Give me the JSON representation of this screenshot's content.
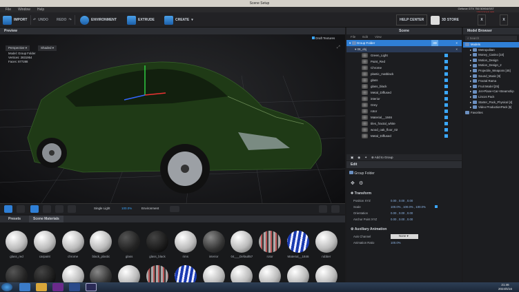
{
  "window": {
    "title": "Scene Setup",
    "menu": [
      "File",
      "Window",
      "Help"
    ],
    "gpu": "Geforce GTX 750 50904/SST",
    "gpu_sub": "1357/2048 MB"
  },
  "toolbar": {
    "import": "IMPORT",
    "undo": "UNDO",
    "redo": "REDO",
    "environment": "ENVIRONMENT",
    "extrude": "EXTRUDE",
    "create": "CREATE",
    "help": "HELP CENTER",
    "store": "3D STORE",
    "close": "X",
    "expand": "X"
  },
  "preview": {
    "title": "Preview",
    "draft": "Draft Textures",
    "view": "Perspective",
    "shade": "Shaded",
    "model_label": "Model:",
    "model": "Group Folder",
    "vertices_label": "Vertices:",
    "vertices": "2831954",
    "faces_label": "Faces:",
    "faces": "877288"
  },
  "viewport_tools": {
    "light": "Single Light",
    "light_val": "100.0%",
    "env": "Environment"
  },
  "scene": {
    "title": "Scene",
    "menu": [
      "File",
      "Edit",
      "View"
    ],
    "group": "Group Folder",
    "group_tag": "3D",
    "obj": "08_obj",
    "items": [
      "Green_Light",
      "Paint_Red",
      "Chrome",
      "plastic_matblack",
      "glass",
      "glass_black",
      "Metal_Diffused",
      "interior",
      "Grey",
      "rotor",
      "Material__1846",
      "tiles_fractal_white",
      "wood_oak_floor_02",
      "Metal_Diffused"
    ],
    "add": "Add to Group"
  },
  "edit": {
    "title": "Edit",
    "group": "Group Folder",
    "transform": "Transform",
    "rows": [
      {
        "k": "Position XYZ",
        "v": "0.00 ,  0.00 ,  0.00"
      },
      {
        "k": "Scale",
        "v": "100.0% ,  100.0% ,  100.0%"
      },
      {
        "k": "Orientation",
        "v": "0.00 ,  0.00 ,  0.00"
      },
      {
        "k": "Anchor Point XYZ",
        "v": "0.00 ,  0.00 ,  0.00"
      }
    ],
    "aux": "Auxiliary Animation",
    "axis_k": "Axis Channel",
    "axis_v": "None",
    "ratio_k": "Animation Ratio",
    "ratio_v": "100.0%"
  },
  "browser": {
    "title": "Model Browser",
    "search": "Search",
    "items": [
      "Models",
      "Metropolitan",
      "Money_Casino [10]",
      "Motion_Design",
      "Motion_Design_2",
      "Projectile_Weapons [45]",
      "Sound_Music [9]",
      "Fractal Rama",
      "Fruit Model [25]",
      "Jet+Plane+Car+Steamship",
      "Lincos Pack",
      "Starter_Pack_Physical [4]",
      "Video ProductionPack [5]",
      "Favorites"
    ]
  },
  "presets": {
    "tab1": "Presets",
    "tab2": "Scene Materials",
    "materials": [
      "glass_red",
      "carpaint",
      "chrome",
      "black_plastic",
      "glass",
      "glass_black",
      "rims",
      "interior",
      "04___Default57",
      "rotor",
      "Material__1846",
      "rubber"
    ]
  },
  "taskbar": {
    "time": "21:46",
    "date": "2024/5/16"
  }
}
